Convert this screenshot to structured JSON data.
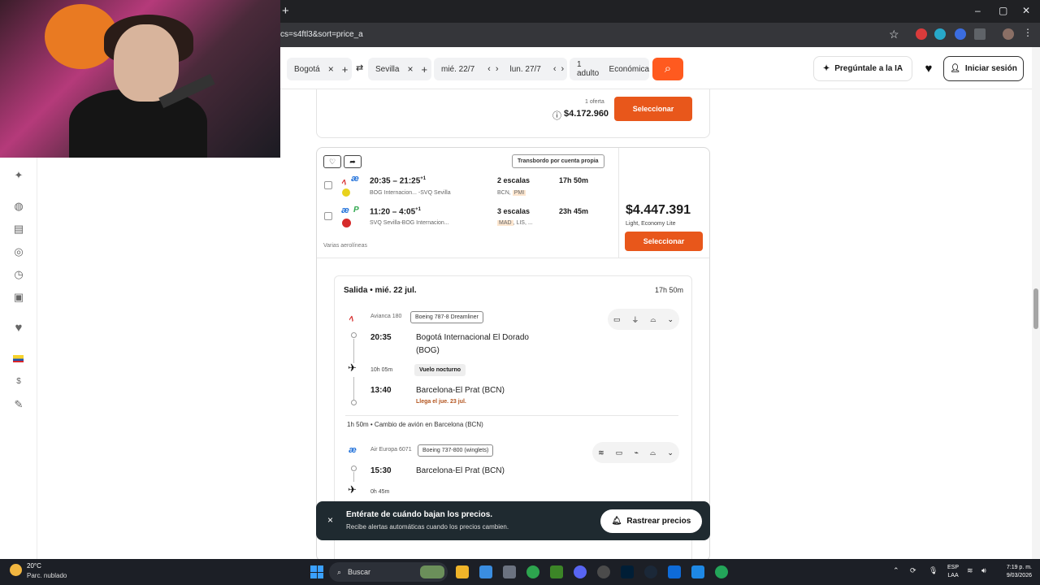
{
  "browser": {
    "new_tab": "+",
    "url": "cs=s4ftl3&sort=price_a",
    "window_controls": [
      "–",
      "▢",
      "✕"
    ]
  },
  "search": {
    "origin": "Bogotá",
    "destination": "Sevilla",
    "depart_date": "mié. 22/7",
    "return_date": "lun. 27/7",
    "passengers": "1 adulto",
    "cabin": "Económica",
    "ask_ai": "Pregúntale a la IA",
    "login": "Iniciar sesión"
  },
  "card1": {
    "offers": "1 oferta",
    "price": "$4.172.960",
    "select": "Seleccionar"
  },
  "card2": {
    "tag": "Transbordo por cuenta propia",
    "outbound": {
      "times": "20:35 – 21:25",
      "plus": "+1",
      "route": "BOG Internacion... -SVQ Sevilla",
      "stops": "2 escalas",
      "codes": [
        "BCN,",
        "PMI"
      ],
      "duration": "17h 50m"
    },
    "inbound": {
      "times": "11:20 – 4:05",
      "plus": "+1",
      "route": "SVQ Sevilla-BOG Internacion...",
      "stops": "3 escalas",
      "codes": [
        "MAD",
        ", LIS, ..."
      ],
      "duration": "23h 45m"
    },
    "carriers": "Varias aerolíneas",
    "price": "$4.447.391",
    "fare": "Light, Economy Lite",
    "select": "Seleccionar"
  },
  "details": {
    "title": "Salida • mié. 22 jul.",
    "total_duration": "17h 50m",
    "seg1": {
      "flight": "Avianca 180",
      "aircraft": "Boeing 787-8 Dreamliner",
      "dep_time": "20:35",
      "dep_place_1": "Bogotá Internacional El Dorado",
      "dep_place_2": "(BOG)",
      "duration": "10h 05m",
      "night": "Vuelo nocturno",
      "arr_time": "13:40",
      "arr_place": "Barcelona-El Prat (BCN)",
      "arrives": "Llega el jue. 23 jul."
    },
    "layover": "1h 50m  •  Cambio de avión en Barcelona (BCN)",
    "seg2": {
      "flight": "Air Europa 6071",
      "aircraft": "Boeing 737-800 (winglets)",
      "dep_time": "15:30",
      "dep_place": "Barcelona-El Prat (BCN)",
      "duration": "0h 45m"
    }
  },
  "toast": {
    "title": "Entérate de cuándo bajan los precios.",
    "subtitle": "Recibe alertas automáticas cuando los precios cambien.",
    "button": "Rastrear precios"
  },
  "taskbar": {
    "temp": "20°C",
    "condition": "Parc. nublado",
    "search": "Buscar",
    "lang_1": "ESP",
    "lang_2": "LAA",
    "time": "7:19 p. m.",
    "date": "9/03/2026"
  },
  "sidebar": {
    "currency": "$"
  },
  "colors": {
    "accent": "#e8571b",
    "toast_bg": "#1f2a30"
  }
}
